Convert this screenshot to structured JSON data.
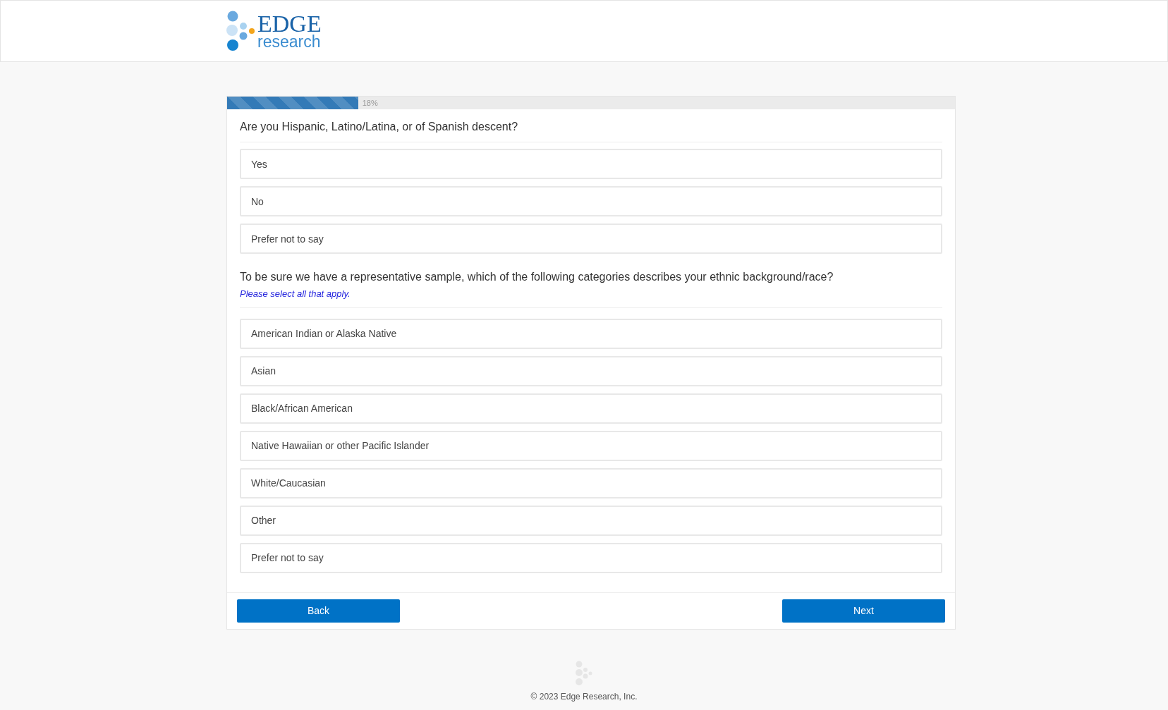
{
  "header": {
    "logo": {
      "word": "EDGE",
      "subword": "research"
    }
  },
  "progress": {
    "level": 0.18,
    "label": "18%"
  },
  "questions": [
    {
      "text": "Are you Hispanic, Latino/Latina, or of Spanish descent?",
      "options": [
        {
          "label": "Yes",
          "selected": false
        },
        {
          "label": "No",
          "selected": false
        },
        {
          "label": "Prefer not to say",
          "selected": false
        }
      ]
    },
    {
      "text": "To be sure we have a representative sample, which of the following categories describes your ethnic background/race?",
      "instruction": "Please select all that apply.",
      "options": [
        {
          "label": "American Indian or Alaska Native",
          "selected": false
        },
        {
          "label": "Asian",
          "selected": false
        },
        {
          "label": "Black/African American",
          "selected": false
        },
        {
          "label": "Native Hawaiian or other Pacific Islander",
          "selected": false
        },
        {
          "label": "White/Caucasian",
          "selected": false
        },
        {
          "label": "Other",
          "selected": false
        },
        {
          "label": "Prefer not to say",
          "selected": false
        }
      ]
    }
  ],
  "buttons": {
    "back": "Back",
    "next": "Next"
  },
  "footer": {
    "copyright": "© 2023 Edge Research, Inc."
  }
}
